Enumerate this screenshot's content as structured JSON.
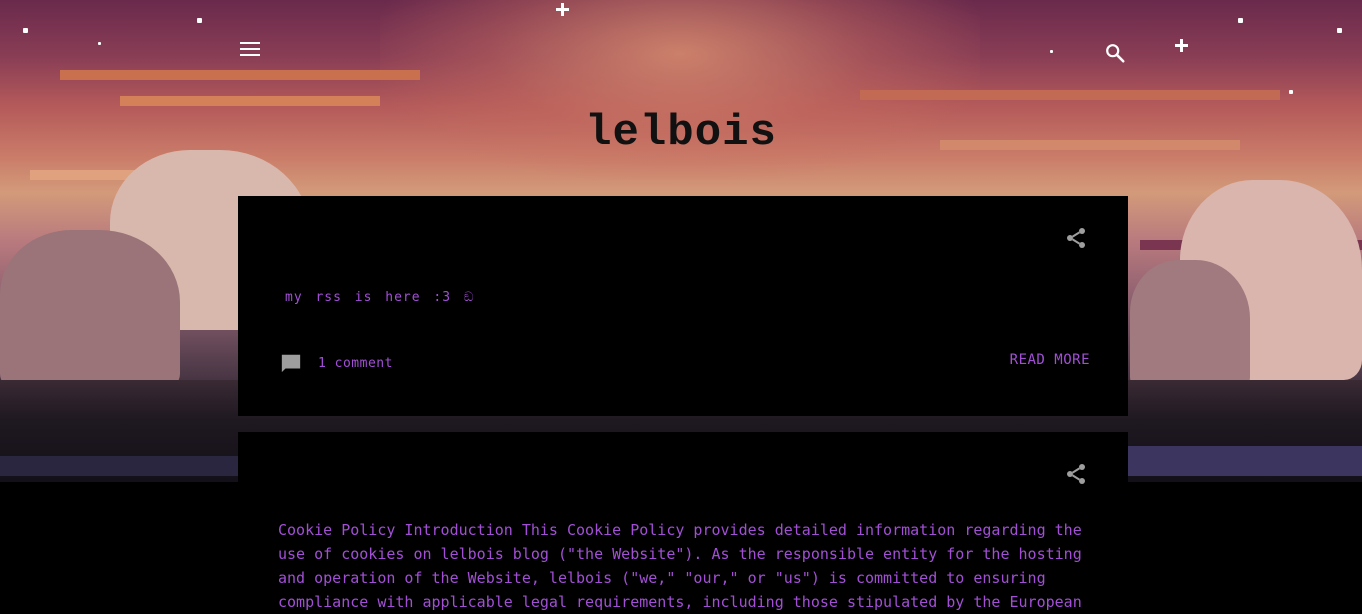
{
  "header": {
    "blog_title": "lelbois"
  },
  "posts": [
    {
      "snippet": "my rss is here :3 ඞ",
      "comments_label": "1 comment",
      "read_more_label": "READ MORE"
    },
    {
      "body": "Cookie Policy Introduction This Cookie Policy provides detailed information regarding the use of cookies on lelbois blog (\"the Website\"). As the responsible entity for the hosting and operation of the Website, lelbois (\"we,\" \"our,\" or \"us\") is committed to ensuring compliance with applicable legal requirements, including those stipulated by the European"
    }
  ],
  "colors": {
    "accent": "#a24fd6",
    "card_background": "#000000",
    "icon_gray": "#9e9e9e"
  },
  "icons": {
    "menu": "menu-icon",
    "search": "search-icon",
    "share": "share-icon",
    "comment": "comment-icon"
  }
}
